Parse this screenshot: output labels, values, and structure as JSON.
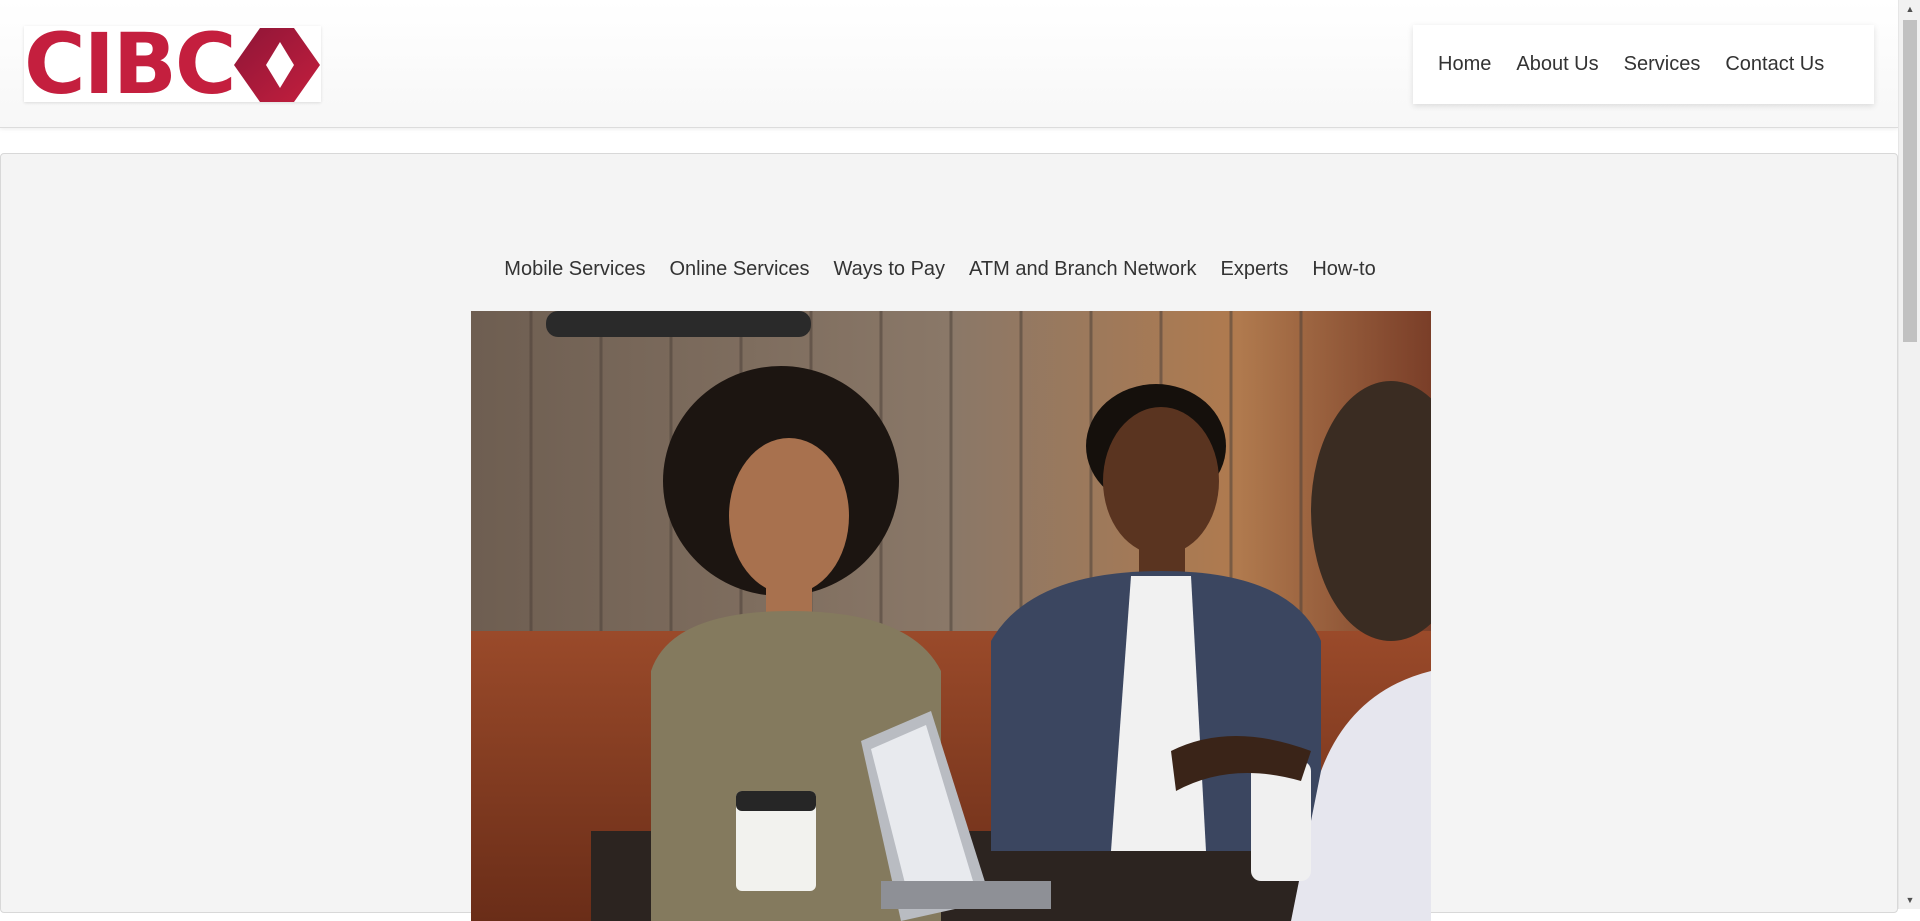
{
  "logo": {
    "text": "CIBC",
    "brand_color": "#c41f3e"
  },
  "top_nav": {
    "items": [
      "Home",
      "About Us",
      "Services",
      "Contact Us"
    ]
  },
  "sub_nav": {
    "items": [
      "Mobile Services",
      "Online Services",
      "Ways to Pay",
      "ATM and Branch Network",
      "Experts",
      "How-to"
    ]
  },
  "hero_image": {
    "icon": "hero-photo"
  },
  "colors": {
    "background": "#f4f4f4",
    "text": "#333333"
  }
}
